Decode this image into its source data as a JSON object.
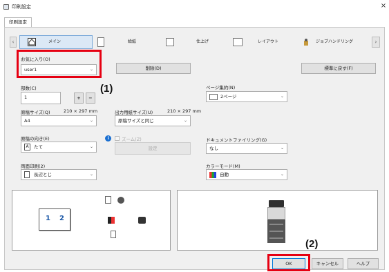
{
  "window": {
    "title": "印刷設定",
    "close_glyph": "×",
    "tab": "印刷設定"
  },
  "toolbar": {
    "back_glyph": "‹",
    "more_glyph": "›",
    "items": [
      {
        "label": "メイン",
        "icon": "home-icon"
      },
      {
        "label": "給紙",
        "icon": "paper-tray-icon"
      },
      {
        "label": "仕上げ",
        "icon": "finishing-icon"
      },
      {
        "label": "レイアウト",
        "icon": "layout-icon"
      },
      {
        "label": "ジョブハンドリング",
        "icon": "job-handling-icon"
      }
    ]
  },
  "favorites": {
    "label": "お気に入り(O)",
    "value": "user1",
    "delete_button": "削除(D)",
    "reset_button": "標準に戻す(F)"
  },
  "copies": {
    "label": "部数(C)",
    "value": "1",
    "plus": "+",
    "minus": "−"
  },
  "original_size": {
    "label": "原稿サイズ(Q)",
    "dims": "210 × 297 mm",
    "value": "A4"
  },
  "output_size": {
    "label": "出力用紙サイズ(U)",
    "dims": "210 × 297 mm",
    "value": "原稿サイズと同じ"
  },
  "orientation": {
    "label": "原稿の向き(E)",
    "value": "たて"
  },
  "zoom": {
    "label": "ズーム(Z)",
    "settings_button": "設定"
  },
  "duplex": {
    "label": "両面印刷(2)",
    "value": "長辺とじ"
  },
  "pages_per_sheet": {
    "label": "ページ集約(N)",
    "value": "2ページ"
  },
  "filing": {
    "label": "ドキュメントファイリング(G)",
    "value": "なし"
  },
  "color_mode": {
    "label": "カラーモード(M)",
    "value": "自動"
  },
  "preview": {
    "page_left": "1",
    "page_right": "2"
  },
  "footer": {
    "ok": "OK",
    "cancel": "キャンセル",
    "help": "ヘルプ"
  },
  "callouts": {
    "one": "(1)",
    "two": "(2)"
  },
  "colors": {
    "highlight": "#e60012",
    "tab_selected": "#dbe8f6"
  }
}
